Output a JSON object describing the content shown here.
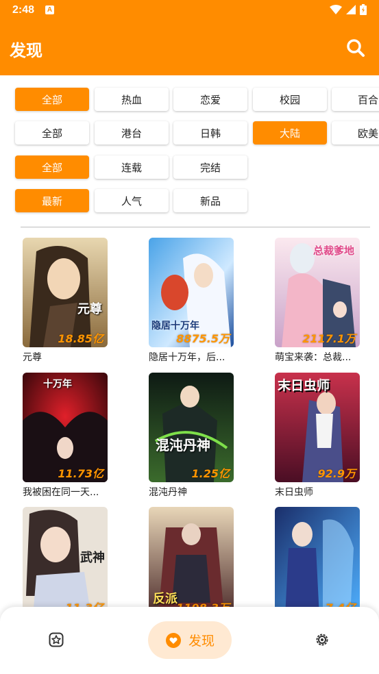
{
  "status": {
    "time": "2:48",
    "notif_letter": "A"
  },
  "header": {
    "title": "发现"
  },
  "filters": {
    "row1": [
      "全部",
      "热血",
      "恋爱",
      "校园",
      "百合"
    ],
    "row2": [
      "全部",
      "港台",
      "日韩",
      "大陆",
      "欧美"
    ],
    "row3": [
      "全部",
      "连载",
      "完结"
    ],
    "row4": [
      "最新",
      "人气",
      "新品"
    ]
  },
  "comics": [
    {
      "name": "元尊",
      "count": "18.85亿",
      "cover_title": "元尊"
    },
    {
      "name": "隐居十万年，后...",
      "count": "8875.5万",
      "cover_title": "隐居十万年"
    },
    {
      "name": "萌宝来袭：总裁...",
      "count": "2117.1万",
      "cover_title": "总裁爹地"
    },
    {
      "name": "我被困在同一天...",
      "count": "11.73亿",
      "cover_title": "十万年"
    },
    {
      "name": "混沌丹神",
      "count": "1.25亿",
      "cover_title": "混沌丹神"
    },
    {
      "name": "末日虫师",
      "count": "92.9万",
      "cover_title": "末日虫师"
    },
    {
      "name": "",
      "count": "11.3亿",
      "cover_title": "武神"
    },
    {
      "name": "",
      "count": "1198.3万",
      "cover_title": "反派"
    },
    {
      "name": "",
      "count": "7.4亿",
      "cover_title": ""
    }
  ],
  "nav": {
    "center_label": "发现"
  },
  "colors": {
    "accent": "#ff8c00",
    "count": "#ff9500",
    "nav_pill": "#ffe9d2"
  }
}
